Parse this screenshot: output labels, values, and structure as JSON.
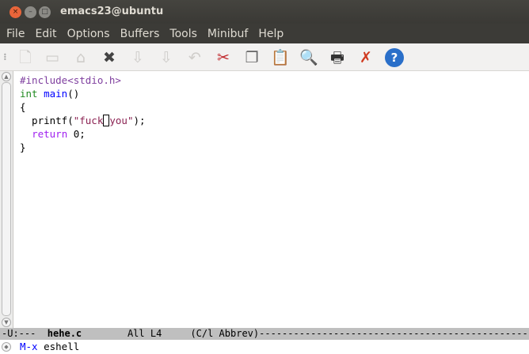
{
  "window": {
    "title": "emacs23@ubuntu"
  },
  "menu": [
    "File",
    "Edit",
    "Options",
    "Buffers",
    "Tools",
    "Minibuf",
    "Help"
  ],
  "toolbar": [
    {
      "icon": "new-file-icon",
      "enabled": false
    },
    {
      "icon": "open-file-icon",
      "enabled": false
    },
    {
      "icon": "open-directory-icon",
      "enabled": false
    },
    {
      "icon": "close-icon",
      "enabled": true
    },
    {
      "icon": "save-icon",
      "enabled": false
    },
    {
      "icon": "save-as-icon",
      "enabled": false
    },
    {
      "icon": "undo-icon",
      "enabled": false
    },
    {
      "icon": "cut-icon",
      "enabled": true
    },
    {
      "icon": "copy-icon",
      "enabled": true
    },
    {
      "icon": "paste-icon",
      "enabled": true
    },
    {
      "icon": "search-icon",
      "enabled": true
    },
    {
      "icon": "print-icon",
      "enabled": true
    },
    {
      "icon": "preferences-icon",
      "enabled": true
    },
    {
      "icon": "help-icon",
      "enabled": true
    }
  ],
  "code": {
    "l1": "#include<stdio.h>",
    "l2a": "int",
    "l2b": "main",
    "l2c": "()",
    "l3": "{",
    "l4a": "  printf(",
    "l4b": "\"fuck",
    "l4c": "you\"",
    "l4d": ");",
    "l5a": "  ",
    "l5b": "return",
    "l5c": " 0;",
    "l6": "}"
  },
  "modeline": {
    "status": "-U:---  ",
    "buffer": "hehe.c",
    "position": "        All L4     ",
    "mode": "(C/l Abbrev)",
    "fill": "------------------------------------------------------------"
  },
  "minibuffer": {
    "prompt": "M-x",
    "input": " eshell"
  }
}
